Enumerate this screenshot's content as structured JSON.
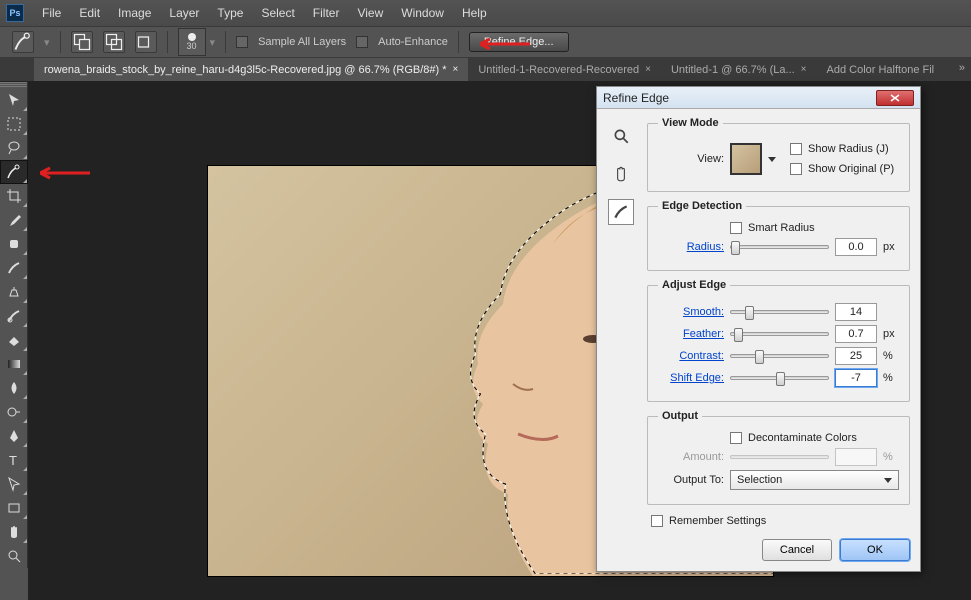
{
  "menu": [
    "File",
    "Edit",
    "Image",
    "Layer",
    "Type",
    "Select",
    "Filter",
    "View",
    "Window",
    "Help"
  ],
  "options": {
    "brush_size": "30",
    "sample_all": "Sample All Layers",
    "auto_enhance": "Auto-Enhance",
    "refine_edge": "Refine Edge..."
  },
  "tabs": [
    {
      "label": "rowena_braids_stock_by_reine_haru-d4g3l5c-Recovered.jpg @ 66.7% (RGB/8#) *",
      "active": true
    },
    {
      "label": "Untitled-1-Recovered-Recovered",
      "active": false
    },
    {
      "label": "Untitled-1 @ 66.7% (La...",
      "active": false
    },
    {
      "label": "Add Color Halftone Fil",
      "active": false
    }
  ],
  "dialog": {
    "title": "Refine Edge",
    "view_mode": {
      "legend": "View Mode",
      "view_label": "View:",
      "show_radius": "Show Radius (J)",
      "show_original": "Show Original (P)"
    },
    "edge_detection": {
      "legend": "Edge Detection",
      "smart_radius": "Smart Radius",
      "radius_label": "Radius:",
      "radius_value": "0.0",
      "radius_unit": "px"
    },
    "adjust_edge": {
      "legend": "Adjust Edge",
      "smooth_label": "Smooth:",
      "smooth_value": "14",
      "feather_label": "Feather:",
      "feather_value": "0.7",
      "feather_unit": "px",
      "contrast_label": "Contrast:",
      "contrast_value": "25",
      "contrast_unit": "%",
      "shift_label": "Shift Edge:",
      "shift_value": "-7",
      "shift_unit": "%"
    },
    "output": {
      "legend": "Output",
      "decontaminate": "Decontaminate Colors",
      "amount_label": "Amount:",
      "amount_unit": "%",
      "output_to_label": "Output To:",
      "output_to_value": "Selection"
    },
    "remember": "Remember Settings",
    "cancel": "Cancel",
    "ok": "OK"
  }
}
